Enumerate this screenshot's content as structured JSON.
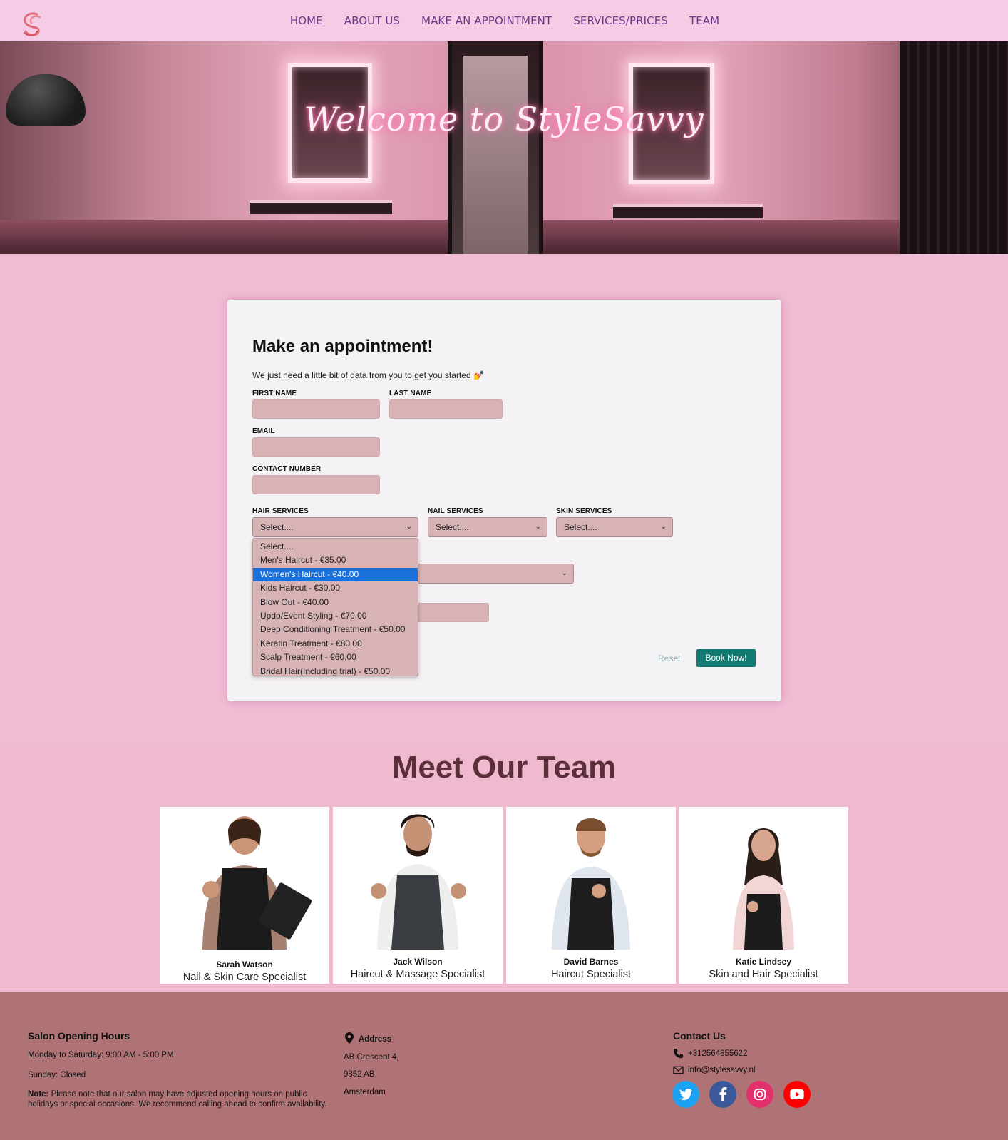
{
  "nav": {
    "items": [
      "HOME",
      "ABOUT US",
      "MAKE AN APPOINTMENT",
      "SERVICES/PRICES",
      "TEAM"
    ]
  },
  "hero": {
    "title": "Welcome to StyleSavvy"
  },
  "form": {
    "title": "Make an appointment!",
    "subtitle": "We just need a little bit of data from you to get you started 💅",
    "first_name_label": "FIRST NAME",
    "last_name_label": "LAST NAME",
    "email_label": "EMAIL",
    "contact_label": "CONTACT NUMBER",
    "hair_label": "HAIR SERVICES",
    "nail_label": "NAIL SERVICES",
    "skin_label": "SKIN SERVICES",
    "hair_value": "Select....",
    "nail_value": "Select....",
    "skin_value": "Select....",
    "hair_options": [
      "Select....",
      "Men's Haircut - €35.00",
      "Women's Haircut - €40.00",
      "Kids Haircut - €30.00",
      "Blow Out - €40.00",
      "Updo/Event Styling - €70.00",
      "Deep Conditioning Treatment - €50.00",
      "Keratin Treatment - €80.00",
      "Scalp Treatment - €60.00",
      "Bridal Hair(Including trial) - €50.00"
    ],
    "highlighted_option": "Women's Haircut - €40.00",
    "reset_label": "Reset",
    "book_label": "Book Now!"
  },
  "team": {
    "title": "Meet Our Team",
    "members": [
      {
        "name": "Sarah Watson",
        "role": "Nail & Skin Care Specialist"
      },
      {
        "name": "Jack Wilson",
        "role": "Haircut & Massage Specialist"
      },
      {
        "name": "David Barnes",
        "role": "Haircut Specialist"
      },
      {
        "name": "Katie Lindsey",
        "role": "Skin and Hair Specialist"
      }
    ]
  },
  "footer": {
    "hours_title": "Salon Opening Hours",
    "hours_weekdays": "Monday to Saturday: 9:00 AM - 5:00 PM",
    "hours_sunday": "Sunday: Closed",
    "note_label": "Note:",
    "note_text": "Please note that our salon may have adjusted opening hours on public holidays or special occasions. We recommend calling ahead to confirm availability.",
    "address_title": "Address",
    "address_lines": [
      "AB Crescent 4,",
      "9852 AB,",
      "Amsterdam"
    ],
    "contact_title": "Contact Us",
    "phone": "+312564855622",
    "email": "info@stylesavvy.nl",
    "social": [
      {
        "icon": "twitter-icon",
        "color": "#1da1f2"
      },
      {
        "icon": "facebook-icon",
        "color": "#3b5998"
      },
      {
        "icon": "instagram-icon",
        "color": "#e1306c"
      },
      {
        "icon": "youtube-icon",
        "color": "#ff0000"
      }
    ]
  },
  "colors": {
    "nav_bg": "#f5cbe6",
    "nav_text": "#6a3a88",
    "input_bg": "#d8b3b6",
    "book_button": "#127a70",
    "footer_bg": "#b07375",
    "highlight": "#1a6fd8"
  }
}
